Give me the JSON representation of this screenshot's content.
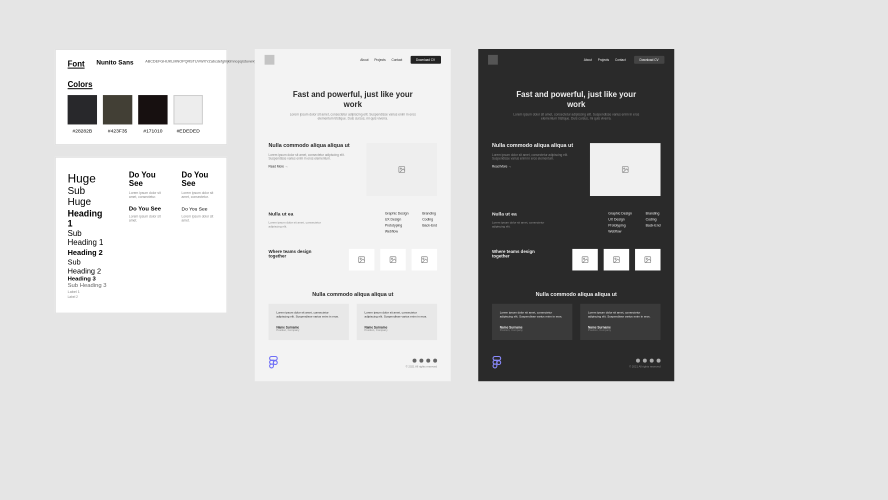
{
  "styleGuide": {
    "fontLabel": "Font",
    "fontName": "Nunito Sans",
    "fontSample": "ABCDEFGHIJKLMNOPQRSTUVWXYZabcdefghijklmnopqrstuvwxyz0123456789",
    "colorsLabel": "Colors",
    "swatches": [
      {
        "hex": "#28282B"
      },
      {
        "hex": "#423F35"
      },
      {
        "hex": "#171010"
      },
      {
        "hex": "#EDEDED"
      }
    ]
  },
  "typeScale": {
    "col1": {
      "huge": "Huge",
      "subhuge": "Sub Huge",
      "h1": "Heading 1",
      "sh1": "Sub Heading 1",
      "h2": "Heading 2",
      "sh2": "Sub Heading 2",
      "h3": "Heading 3",
      "sh3": "Sub Heading 3",
      "label1": "Label 1",
      "label2": "Label 2"
    },
    "col2": {
      "title": "Do You See",
      "body1": "Lorem ipsum dolor sit amet, consectetur.",
      "sub": "Do You See",
      "body2": "Lorem ipsum dolor sit amet."
    },
    "col3": {
      "title": "Do You See",
      "body1": "Lorem ipsum dolor sit amet, consectetur.",
      "sub": "Do You See",
      "body2": "Lorem ipsum dolor sit amet."
    }
  },
  "mock": {
    "nav": {
      "items": [
        "About",
        "Projects",
        "Contact"
      ],
      "cta": "Download CV"
    },
    "hero": {
      "title": "Fast and powerful, just like your work",
      "body": "Lorem ipsum dolor sit amet, consectetur adipiscing elit. Suspendisse varius enim in eros elementum tristique. Duis cursus, mi quis viverra."
    },
    "feature1": {
      "title": "Nulla commodo aliqua aliqua ut",
      "body": "Lorem ipsum dolor sit amet, consectetur adipiscing elit. Suspendisse varius enim in eros elementum.",
      "link": "Read More  →"
    },
    "skills": {
      "title": "Nulla ut ea",
      "body": "Lorem ipsum dolor sit amet, consectetur adipiscing elit.",
      "items": [
        "Graphic Design",
        "Branding",
        "UX Design",
        "Coding",
        "Prototyping",
        "Back-End",
        "Webflow",
        ""
      ]
    },
    "team": {
      "title": "Where teams design together"
    },
    "testimonials": {
      "title": "Nulla commodo aliqua aliqua ut",
      "items": [
        {
          "quote": "Lorem ipsum dolor sit amet, consectetur adipiscing elit. Suspendisse varius enim in eros.",
          "name": "Name Surname",
          "role": "Position, Company"
        },
        {
          "quote": "Lorem ipsum dolor sit amet, consectetur adipiscing elit. Suspendisse varius enim in eros.",
          "name": "Name Surname",
          "role": "Position, Company"
        }
      ]
    },
    "footer": {
      "copy": "© 2021 All rights reserved"
    }
  }
}
